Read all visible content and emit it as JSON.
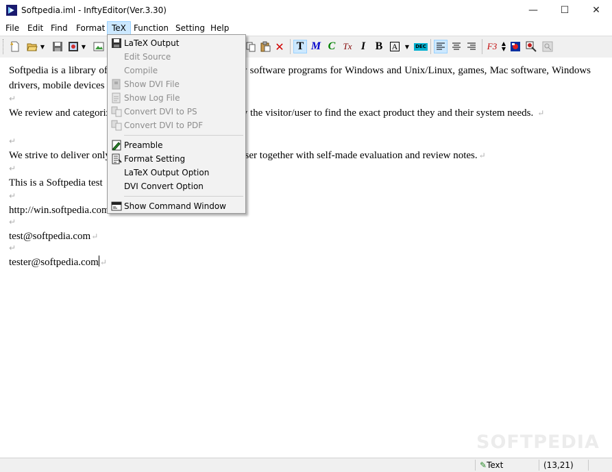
{
  "window": {
    "title": "Softpedia.iml - InftyEditor(Ver.3.30)",
    "minimize": "—",
    "maximize": "☐",
    "close": "✕"
  },
  "menubar": {
    "items": [
      "File",
      "Edit",
      "Find",
      "Format",
      "TeX",
      "Function",
      "Setting",
      "Help"
    ],
    "active": "TeX"
  },
  "toolbar": {
    "text_mode_letter": "T",
    "math_letter": "M",
    "chem_letter": "C",
    "tex_letter": "Tx",
    "italic_letter": "I",
    "bold_letter": "B",
    "boxed_letter": "A",
    "dec_label": "DEC",
    "function_label": "F3"
  },
  "document": {
    "paragraphs": [
      "Softpedia is a library of over 400,000 free and free-to-try software programs for Windows and Unix/Linux, games, Mac software, Windows drivers, mobile devices and IT-related articles.",
      "We review and categorize these products in order to allow the visitor/user to find the exact product they and their system needs.",
      "We strive to deliver only the best products to the visitor/user together with self-made evaluation and review notes.",
      "This is a Softpedia test",
      "http://win.softpedia.com",
      "test@softpedia.com",
      "tester@softpedia.com"
    ],
    "return_mark": "↵"
  },
  "tex_menu": {
    "items": [
      {
        "label": "LaTeX Output",
        "enabled": true,
        "icon": "save-latex-icon"
      },
      {
        "label": "Edit Source",
        "enabled": false,
        "icon": ""
      },
      {
        "label": "Compile",
        "enabled": false,
        "icon": ""
      },
      {
        "label": "Show DVI File",
        "enabled": false,
        "icon": "dvi-file-icon"
      },
      {
        "label": "Show Log File",
        "enabled": false,
        "icon": "log-file-icon"
      },
      {
        "label": "Convert DVI to PS",
        "enabled": false,
        "icon": "convert-ps-icon"
      },
      {
        "label": "Convert DVI to PDF",
        "enabled": false,
        "icon": "convert-pdf-icon"
      },
      {
        "label": "Preamble",
        "enabled": true,
        "icon": "preamble-icon"
      },
      {
        "label": "Format Setting",
        "enabled": true,
        "icon": "format-setting-icon"
      },
      {
        "label": "LaTeX Output Option",
        "enabled": true,
        "icon": ""
      },
      {
        "label": "DVI Convert Option",
        "enabled": true,
        "icon": ""
      },
      {
        "label": "Show Command Window",
        "enabled": true,
        "icon": "command-window-icon"
      }
    ]
  },
  "statusbar": {
    "mode": "Text",
    "position": "(13,21)"
  },
  "watermark": "SOFTPEDIA",
  "colors": {
    "menu_highlight": "#cce8ff",
    "toolbar_bg": "#f0f0f0",
    "math_blue": "#0000cc",
    "chem_green": "#008000"
  }
}
